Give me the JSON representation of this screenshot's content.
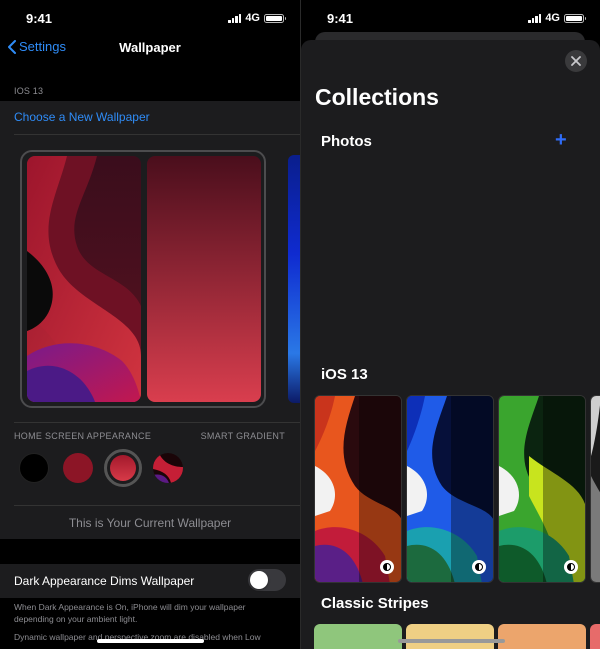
{
  "status": {
    "time": "9:41",
    "network": "4G"
  },
  "left": {
    "back_label": "Settings",
    "title": "Wallpaper",
    "section_label": "IOS 13",
    "choose_new": "Choose a New Wallpaper",
    "appearance_label": "HOME SCREEN APPEARANCE",
    "smart_gradient_label": "SMART GRADIENT",
    "current_text": "This is Your Current Wallpaper",
    "dark_dims_label": "Dark Appearance Dims Wallpaper",
    "dark_dims_on": false,
    "footer_note": "When Dark Appearance is On, iPhone will dim your wallpaper depending on your ambient light.",
    "footer_note_2": "Dynamic wallpaper and perspective zoom are disabled when Low"
  },
  "right": {
    "close_icon": "close-icon",
    "title": "Collections",
    "photos_heading": "Photos",
    "add_icon": "plus-icon",
    "ios13_heading": "iOS 13",
    "stripes_heading": "Classic Stripes"
  },
  "colors": {
    "accent": "#2f8cf7",
    "background": "#000000",
    "group_background": "#1c1c1e",
    "secondary_text": "#8d8d92",
    "stripe_colors": [
      "#8fc67c",
      "#efcf84",
      "#eca56c",
      "#e76b6a"
    ]
  }
}
